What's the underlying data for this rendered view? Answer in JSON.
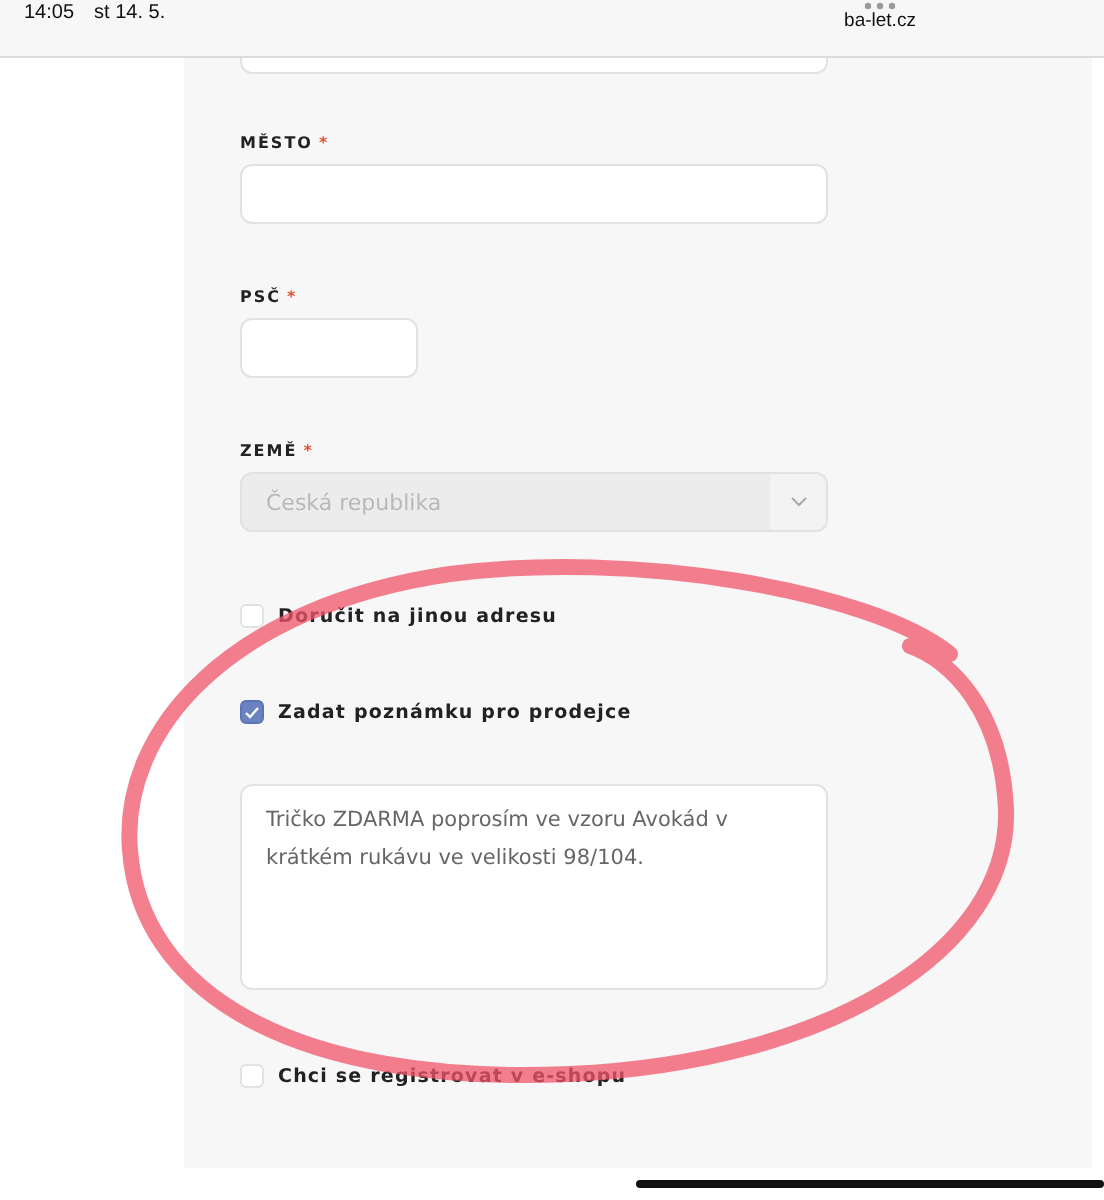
{
  "status_bar": {
    "time": "14:05",
    "date": "st 14. 5.",
    "url": "ba-let.cz"
  },
  "fields": [
    {
      "kind": "text",
      "label": "MĚSTO",
      "required_mark": "*"
    },
    {
      "kind": "zip",
      "label": "PSČ",
      "required_mark": "*"
    },
    {
      "kind": "select",
      "label": "ZEMĚ",
      "required_mark": "*",
      "value": "Česká republika",
      "disabled": true
    }
  ],
  "options": [
    {
      "kind": "checkbox",
      "label": "Doručit na jinou adresu",
      "checked": false
    },
    {
      "kind": "checkbox",
      "label": "Zadat poznámku pro prodejce",
      "checked": true
    },
    {
      "kind": "note",
      "value": "Tričko ZDARMA poprosím ve vzoru Avokád v krátkém rukávu ve velikosti 98/104."
    },
    {
      "kind": "checkbox",
      "label": "Chci se registrovat v e-shopu",
      "checked": false
    }
  ]
}
